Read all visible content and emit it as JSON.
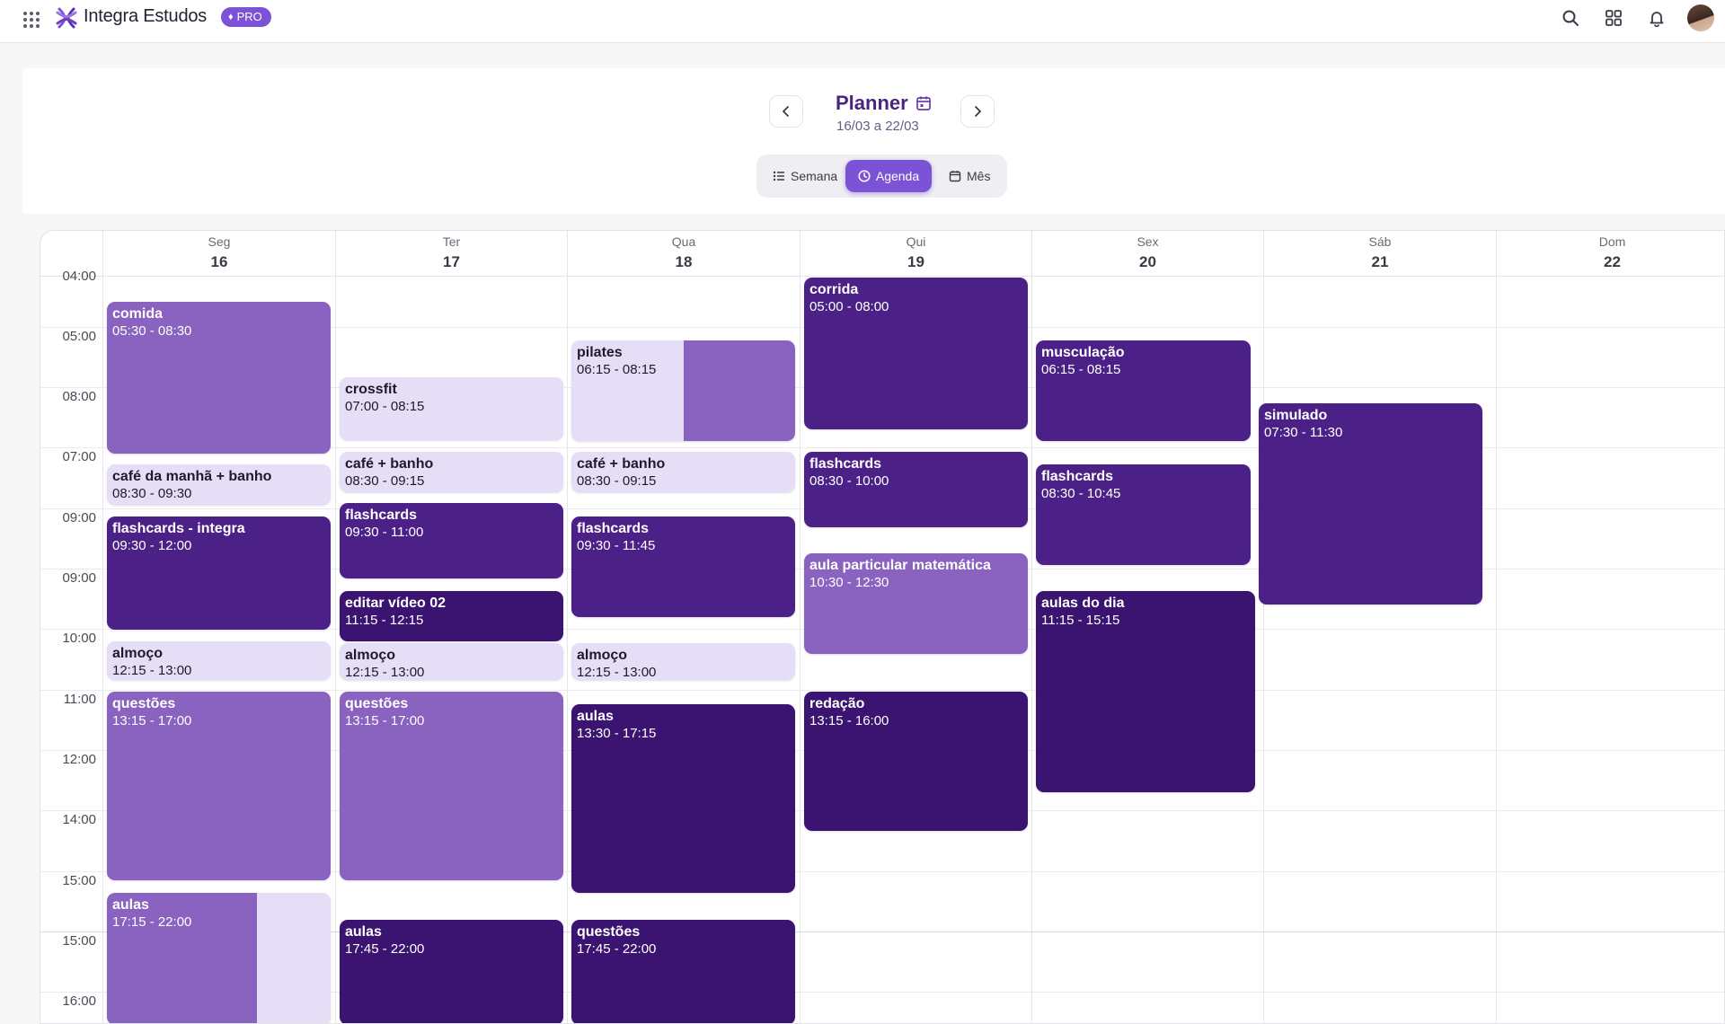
{
  "topbar": {
    "app_name": "Integra Estudos",
    "pro_label": "PRO",
    "icons": [
      "apps-grid-icon",
      "search-icon",
      "widgets-icon",
      "bell-icon",
      "avatar"
    ]
  },
  "header": {
    "title": "Planner",
    "date_range": "16/03 a 22/03",
    "views": {
      "semana": "Semana",
      "agenda": "Agenda",
      "mes": "Mês"
    },
    "active_view": "Agenda"
  },
  "colors": {
    "accent": "#7c52d6",
    "title": "#4a2580",
    "event_light": "#e6ddf6",
    "event_mid": "#8a62bf",
    "event_dark": "#4c2187",
    "event_darkest": "#3a1470"
  },
  "days": [
    {
      "name": "Seg",
      "num": "16"
    },
    {
      "name": "Ter",
      "num": "17"
    },
    {
      "name": "Qua",
      "num": "18"
    },
    {
      "name": "Qui",
      "num": "19"
    },
    {
      "name": "Sex",
      "num": "20"
    },
    {
      "name": "Sáb",
      "num": "21"
    },
    {
      "name": "Dom",
      "num": "22"
    }
  ],
  "times": [
    "04:00",
    "05:00",
    "08:00",
    "07:00",
    "09:00",
    "09:00",
    "10:00",
    "11:00",
    "12:00",
    "14:00",
    "15:00",
    "15:00",
    "16:00"
  ],
  "events": {
    "seg": [
      {
        "title": "comida",
        "time": "05:30 - 08:30"
      },
      {
        "title": "café da manhã + banho",
        "time": "08:30 - 09:30"
      },
      {
        "title": "flashcards - integra",
        "time": "09:30 - 12:00"
      },
      {
        "title": "almoço",
        "time": "12:15 - 13:00"
      },
      {
        "title": "questões",
        "time": "13:15 - 17:00"
      },
      {
        "title": "aulas",
        "time": "17:15 - 22:00"
      }
    ],
    "ter": [
      {
        "title": "crossfit",
        "time": "07:00 - 08:15"
      },
      {
        "title": "café + banho",
        "time": "08:30 - 09:15"
      },
      {
        "title": "flashcards",
        "time": "09:30 - 11:00"
      },
      {
        "title": "editar vídeo 02",
        "time": "11:15 - 12:15"
      },
      {
        "title": "almoço",
        "time": "12:15 - 13:00"
      },
      {
        "title": "questões",
        "time": "13:15 - 17:00"
      },
      {
        "title": "aulas",
        "time": "17:45 - 22:00"
      }
    ],
    "qua": [
      {
        "title": "pilates",
        "time": "06:15 - 08:15"
      },
      {
        "title": "café + banho",
        "time": "08:30 - 09:15"
      },
      {
        "title": "flashcards",
        "time": "09:30 - 11:45"
      },
      {
        "title": "almoço",
        "time": "12:15 - 13:00"
      },
      {
        "title": "aulas",
        "time": "13:30 - 17:15"
      },
      {
        "title": "questões",
        "time": "17:45 - 22:00"
      }
    ],
    "qui": [
      {
        "title": "corrida",
        "time": "05:00 - 08:00"
      },
      {
        "title": "flashcards",
        "time": "08:30 - 10:00"
      },
      {
        "title": "aula particular matemática",
        "time": "10:30 - 12:30"
      },
      {
        "title": "redação",
        "time": "13:15 - 16:00"
      }
    ],
    "sex": [
      {
        "title": "musculação",
        "time": "06:15 - 08:15"
      },
      {
        "title": "flashcards",
        "time": "08:30 - 10:45"
      },
      {
        "title": "aulas do dia",
        "time": "11:15 - 15:15"
      }
    ],
    "sab": [
      {
        "title": "simulado",
        "time": "07:30 - 11:30"
      }
    ]
  }
}
